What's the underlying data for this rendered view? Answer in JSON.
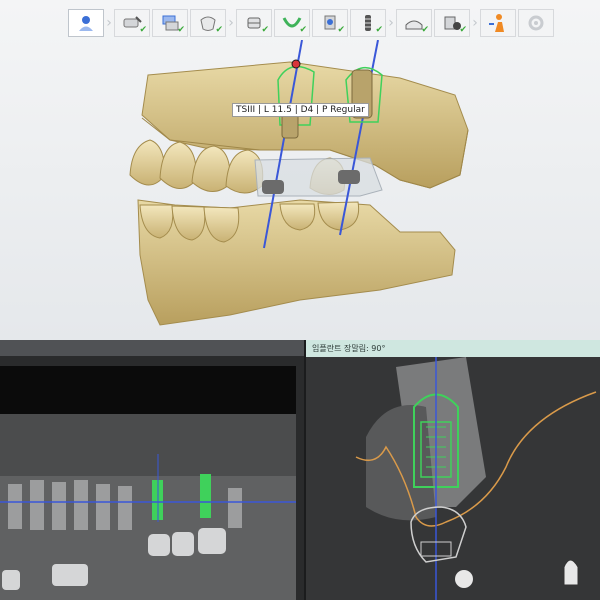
{
  "toolbar": {
    "buttons": [
      {
        "icon": "patient-scan-icon",
        "active": true,
        "checked": false
      },
      {
        "icon": "scan-pen-icon",
        "checked": true
      },
      {
        "icon": "scan-align-icon",
        "checked": true
      },
      {
        "icon": "crown-shape-icon",
        "checked": true
      },
      {
        "icon": "sleeve-icon",
        "checked": true
      },
      {
        "icon": "arch-curve-icon",
        "checked": true
      },
      {
        "icon": "nerve-mark-icon",
        "checked": true
      },
      {
        "icon": "implant-icon",
        "checked": true
      },
      {
        "icon": "guide-base-icon",
        "checked": true
      },
      {
        "icon": "sleeve-check-icon",
        "checked": true
      },
      {
        "icon": "person-export-icon",
        "checked": false
      },
      {
        "icon": "disabled-gear-icon",
        "checked": false
      }
    ]
  },
  "implant_tooltip": "TSIII | L 11.5 | D4 | P Regular",
  "cross_section": {
    "title": "임플란트 장말림: 90°"
  },
  "colors": {
    "model": "#d9c48d",
    "implant_outline": "#3fd15b",
    "axis": "#3a57d8",
    "panel_header": "#cfe7e0"
  }
}
